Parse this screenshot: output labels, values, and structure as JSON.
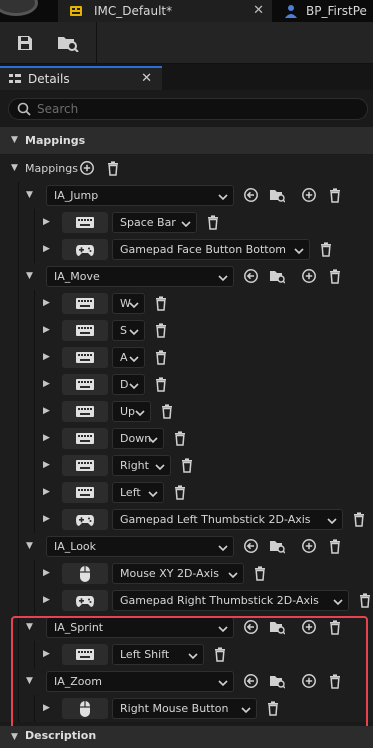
{
  "tabs": [
    {
      "label": "IMC_Default*",
      "active": true
    },
    {
      "label": "BP_FirstPe",
      "active": false
    }
  ],
  "details": {
    "tab_label": "Details",
    "search_placeholder": "Search"
  },
  "categories": {
    "mappings": "Mappings",
    "description": "Description"
  },
  "mappings_array_label": "Mappings",
  "actions": [
    {
      "name": "IA_Jump",
      "keys": [
        {
          "key": "Space Bar",
          "device": "keyboard"
        },
        {
          "key": "Gamepad Face Button Bottom",
          "device": "gamepad"
        }
      ]
    },
    {
      "name": "IA_Move",
      "keys": [
        {
          "key": "W",
          "device": "keyboard"
        },
        {
          "key": "S",
          "device": "keyboard"
        },
        {
          "key": "A",
          "device": "keyboard"
        },
        {
          "key": "D",
          "device": "keyboard"
        },
        {
          "key": "Up",
          "device": "keyboard"
        },
        {
          "key": "Down",
          "device": "keyboard"
        },
        {
          "key": "Right",
          "device": "keyboard"
        },
        {
          "key": "Left",
          "device": "keyboard"
        },
        {
          "key": "Gamepad Left Thumbstick 2D-Axis",
          "device": "gamepad"
        }
      ]
    },
    {
      "name": "IA_Look",
      "keys": [
        {
          "key": "Mouse XY 2D-Axis",
          "device": "mouse"
        },
        {
          "key": "Gamepad Right Thumbstick 2D-Axis",
          "device": "gamepad"
        }
      ]
    },
    {
      "name": "IA_Sprint",
      "keys": [
        {
          "key": "Left Shift",
          "device": "keyboard"
        }
      ]
    },
    {
      "name": "IA_Zoom",
      "keys": [
        {
          "key": "Right Mouse Button",
          "device": "mouse"
        }
      ]
    }
  ],
  "colors": {
    "highlight": "#e8424f",
    "accent": "#2a6fd6"
  }
}
